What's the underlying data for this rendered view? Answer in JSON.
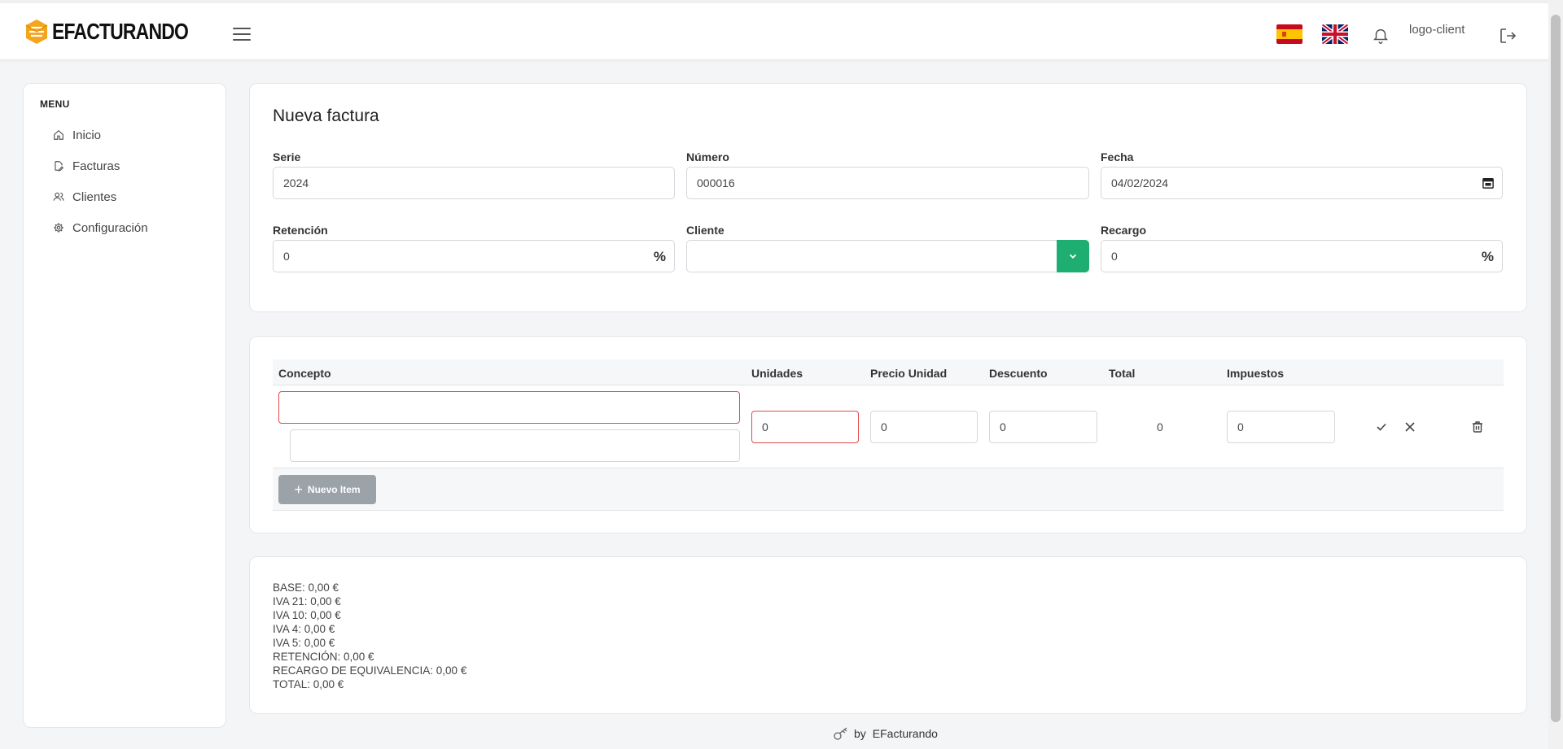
{
  "brand": {
    "name": "EFACTURANDO"
  },
  "header": {
    "logo_client_alt": "logo-client"
  },
  "sidebar": {
    "title": "MENU",
    "items": [
      {
        "label": "Inicio",
        "icon": "home-icon"
      },
      {
        "label": "Facturas",
        "icon": "invoice-edit-icon"
      },
      {
        "label": "Clientes",
        "icon": "users-icon"
      },
      {
        "label": "Configuración",
        "icon": "gear-icon"
      }
    ]
  },
  "form": {
    "title": "Nueva factura",
    "serie": {
      "label": "Serie",
      "value": "2024"
    },
    "numero": {
      "label": "Número",
      "value": "000016"
    },
    "fecha": {
      "label": "Fecha",
      "value": "04/02/2024"
    },
    "retencion": {
      "label": "Retención",
      "value": "0",
      "suffix": "%"
    },
    "cliente": {
      "label": "Cliente",
      "value": ""
    },
    "recargo": {
      "label": "Recargo",
      "value": "0",
      "suffix": "%"
    }
  },
  "items_table": {
    "columns": [
      "Concepto",
      "Unidades",
      "Precio Unidad",
      "Descuento",
      "Total",
      "Impuestos"
    ],
    "row": {
      "concepto": "",
      "descripcion": "",
      "unidades": "0",
      "precio_unidad": "0",
      "descuento": "0",
      "total": "0",
      "impuestos": "0"
    },
    "new_item_label": "Nuevo Item"
  },
  "summary": {
    "lines": [
      "BASE: 0,00 €",
      "IVA 21: 0,00 €",
      "IVA 10: 0,00 €",
      "IVA 4: 0,00 €",
      "IVA 5: 0,00 €",
      "RETENCIÓN: 0,00 €",
      "RECARGO DE EQUIVALENCIA: 0,00 €",
      "TOTAL: 0,00 €"
    ]
  },
  "footer": {
    "by": "by",
    "brand": "EFacturando"
  },
  "colors": {
    "accent_green": "#1fae71",
    "logo_orange": "#f4a51c",
    "error_red": "#e04b4b",
    "button_gray": "#9ba2a8"
  }
}
